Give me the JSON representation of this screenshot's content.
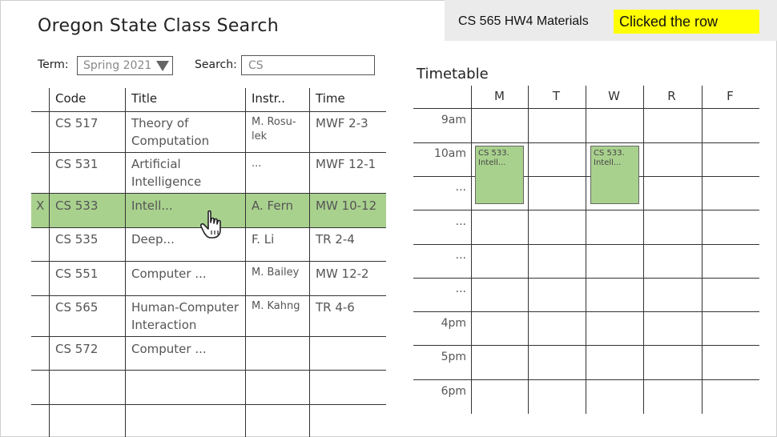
{
  "app_title": "Oregon State Class Search",
  "header": {
    "title": "CS 565 HW4 Materials",
    "status": "Clicked the row",
    "status_color": "#ffff00"
  },
  "filters": {
    "term_label": "Term:",
    "term_value": "Spring 2021",
    "search_label": "Search:",
    "search_value": "CS"
  },
  "table": {
    "headers": [
      "Code",
      "Title",
      "Instr..",
      "Time"
    ],
    "selected_marker": "X",
    "rows": [
      {
        "code": "CS 517",
        "title1": "Theory of",
        "title2": "Computation",
        "instr1": "M. Rosu-",
        "instr2": "lek",
        "time": "MWF 2-3"
      },
      {
        "code": "CS 531",
        "title1": "Artificial",
        "title2": "Intelligence",
        "instr1": "...",
        "instr2": "",
        "time": "MWF 12-1"
      },
      {
        "code": "CS 533",
        "title1": "Intell...",
        "title2": "",
        "instr1": "A. Fern",
        "instr2": "",
        "time": "MW 10-12"
      },
      {
        "code": "CS 535",
        "title1": "Deep...",
        "title2": "",
        "instr1": "F. Li",
        "instr2": "",
        "time": "TR 2-4"
      },
      {
        "code": "CS 551",
        "title1": "Computer ...",
        "title2": "",
        "instr1": "M. Bailey",
        "instr2": "",
        "time": "MW 12-2"
      },
      {
        "code": "CS 565",
        "title1": "Human-Computer",
        "title2": "Interaction",
        "instr1": "M. Kahng",
        "instr2": "",
        "time": "TR 4-6"
      },
      {
        "code": "CS 572",
        "title1": "Computer ...",
        "title2": "",
        "instr1": "",
        "instr2": "",
        "time": ""
      }
    ],
    "highlight_color": "#a9d18e"
  },
  "timetable": {
    "title": "Timetable",
    "days": [
      "M",
      "T",
      "W",
      "R",
      "F"
    ],
    "times": [
      "9am",
      "10am",
      "...",
      "...",
      "...",
      "...",
      "4pm",
      "5pm",
      "6pm"
    ],
    "blocks": [
      {
        "day": "M",
        "line1": "CS 533.",
        "line2": "Intell..."
      },
      {
        "day": "W",
        "line1": "CS 533.",
        "line2": "Intell..."
      }
    ]
  }
}
